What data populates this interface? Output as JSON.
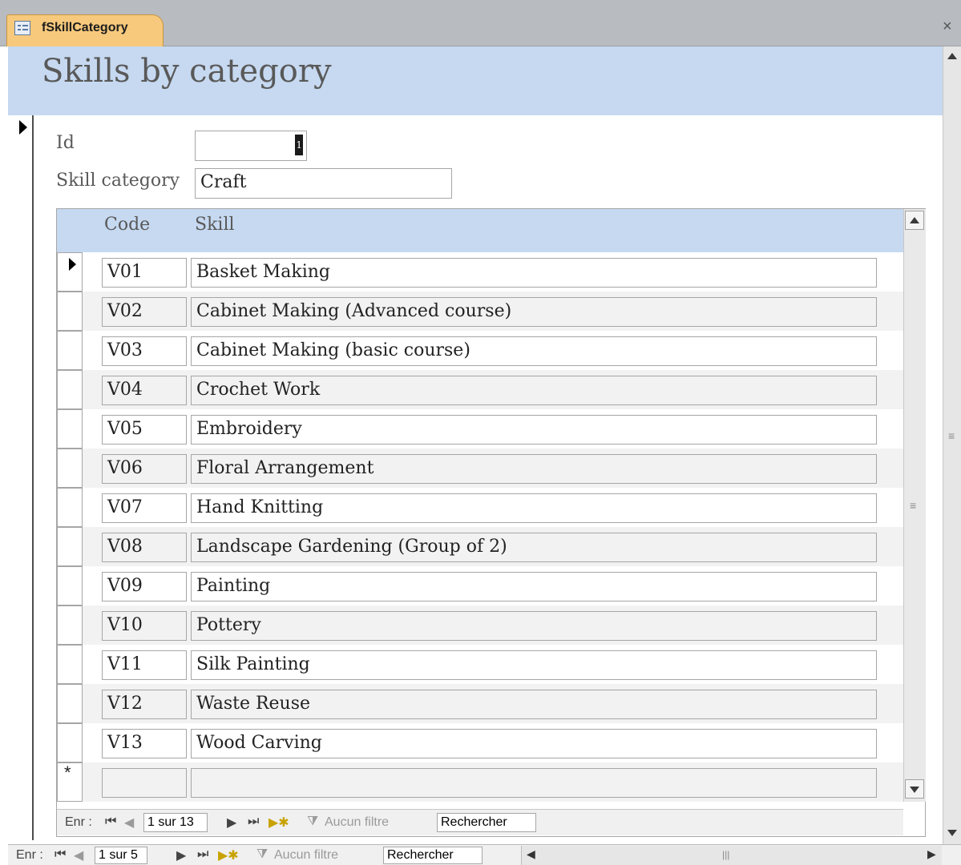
{
  "tab": {
    "title": "fSkillCategory",
    "close_glyph": "×"
  },
  "header": {
    "title": "Skills by category"
  },
  "form": {
    "id_label": "Id",
    "id_value": "1",
    "category_label": "Skill category",
    "category_value": "Craft"
  },
  "subform": {
    "columns": {
      "code": "Code",
      "skill": "Skill"
    },
    "rows": [
      {
        "code": "V01",
        "skill": "Basket Making"
      },
      {
        "code": "V02",
        "skill": "Cabinet Making (Advanced course)"
      },
      {
        "code": "V03",
        "skill": "Cabinet Making (basic course)"
      },
      {
        "code": "V04",
        "skill": "Crochet Work"
      },
      {
        "code": "V05",
        "skill": "Embroidery"
      },
      {
        "code": "V06",
        "skill": "Floral Arrangement"
      },
      {
        "code": "V07",
        "skill": "Hand Knitting"
      },
      {
        "code": "V08",
        "skill": "Landscape Gardening (Group of 2)"
      },
      {
        "code": "V09",
        "skill": "Painting"
      },
      {
        "code": "V10",
        "skill": "Pottery"
      },
      {
        "code": "V11",
        "skill": "Silk Painting"
      },
      {
        "code": "V12",
        "skill": "Waste Reuse"
      },
      {
        "code": "V13",
        "skill": "Wood Carving"
      }
    ],
    "new_row_marker": "*",
    "nav": {
      "label": "Enr :",
      "position": "1 sur 13",
      "filter": "Aucun filtre",
      "search": "Rechercher"
    }
  },
  "main_nav": {
    "label": "Enr :",
    "position": "1 sur 5",
    "filter": "Aucun filtre",
    "search": "Rechercher"
  },
  "colors": {
    "header_band": "#c6d9f1",
    "tab_active": "#f7c97c",
    "alt_row": "#f2f2f2"
  },
  "icons": [
    "form-icon",
    "record-pointer-icon",
    "first-record-icon",
    "prev-record-icon",
    "next-record-icon",
    "last-record-icon",
    "new-record-icon",
    "filter-icon",
    "close-icon",
    "scroll-up-icon",
    "scroll-down-icon"
  ]
}
